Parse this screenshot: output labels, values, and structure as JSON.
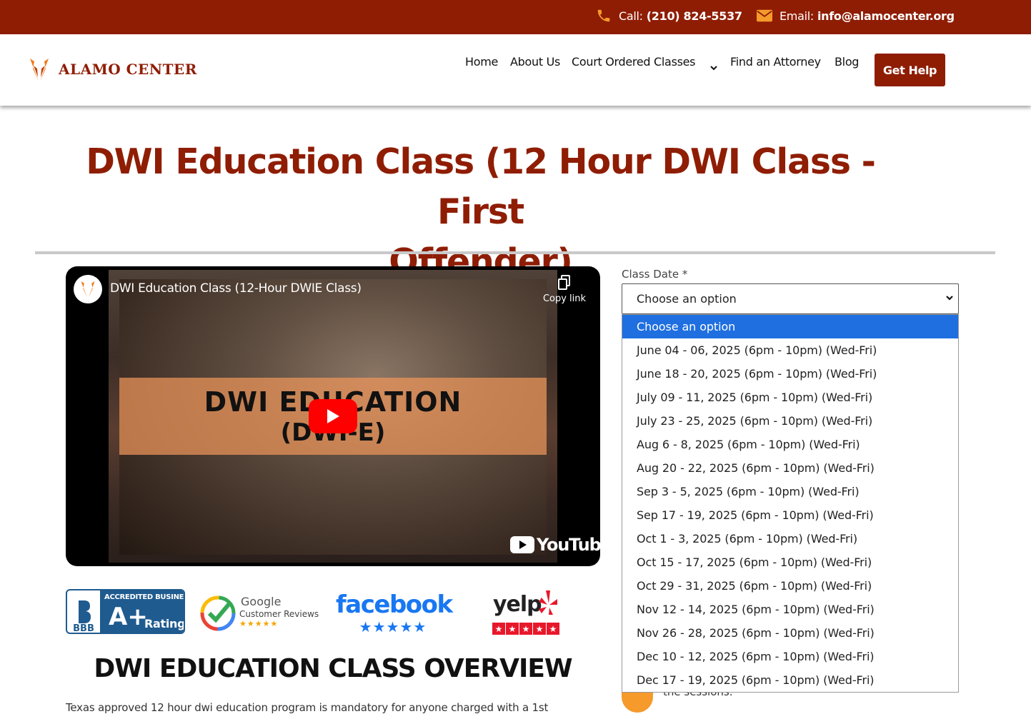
{
  "topbar": {
    "phone_label": "Call:",
    "phone_number": "(210) 824-5537",
    "email_label": "Email:",
    "email_address": "info@alamocenter.org"
  },
  "header": {
    "logo_text": "ALAMO CENTER",
    "nav": [
      "Home",
      "About Us",
      "Court Ordered Classes",
      "Find an Attorney",
      "Blog"
    ],
    "cta": "Get Help"
  },
  "page": {
    "title_line1": "DWI Education Class (12 Hour DWI Class - First",
    "title_line2": "Offender)"
  },
  "video": {
    "title": "DWI Education Class (12-Hour DWIE Class)",
    "copy_link": "Copy link",
    "thumb_line1": "DWI EDUCATION",
    "thumb_line2": "(DWI-E)",
    "platform": "YouTube"
  },
  "badges": {
    "bbb_top": "ACCREDITED BUSINESS",
    "bbb_grade": "A+",
    "bbb_rating": "Rating",
    "bbb_abbr": "BBB",
    "google_brand": "Google",
    "google_sub": "Customer Reviews",
    "google_stars": "★★★★★",
    "facebook": "facebook",
    "facebook_stars": "★★★★★",
    "yelp": "yelp"
  },
  "overview": {
    "heading": "DWI EDUCATION CLASS OVERVIEW",
    "text": "Texas approved 12 hour dwi education program is mandatory for anyone charged with a 1st"
  },
  "form": {
    "label": "Class Date",
    "required_mark": "*",
    "selected": "Choose an option",
    "options": [
      "Choose an option",
      "June 04 - 06, 2025 (6pm - 10pm) (Wed-Fri)",
      "June 18 - 20, 2025 (6pm - 10pm) (Wed-Fri)",
      "July 09 - 11, 2025 (6pm - 10pm) (Wed-Fri)",
      "July 23 - 25, 2025 (6pm - 10pm) (Wed-Fri)",
      "Aug 6 - 8, 2025 (6pm - 10pm) (Wed-Fri)",
      "Aug 20 - 22, 2025 (6pm - 10pm) (Wed-Fri)",
      "Sep 3 - 5, 2025 (6pm - 10pm) (Wed-Fri)",
      "Sep 17 - 19, 2025 (6pm - 10pm) (Wed-Fri)",
      "Oct 1 - 3, 2025 (6pm - 10pm) (Wed-Fri)",
      "Oct 15 - 17, 2025 (6pm - 10pm) (Wed-Fri)",
      "Oct 29 - 31, 2025 (6pm - 10pm) (Wed-Fri)",
      "Nov 12 - 14, 2025 (6pm - 10pm) (Wed-Fri)",
      "Nov 26 - 28, 2025 (6pm - 10pm) (Wed-Fri)",
      "Dec 10 - 12, 2025 (6pm - 10pm) (Wed-Fri)",
      "Dec 17 - 19, 2025 (6pm - 10pm) (Wed-Fri)"
    ],
    "peek_text": "the sessions."
  },
  "colors": {
    "brand": "#8f1d04",
    "select_highlight": "#1f6fe0"
  }
}
